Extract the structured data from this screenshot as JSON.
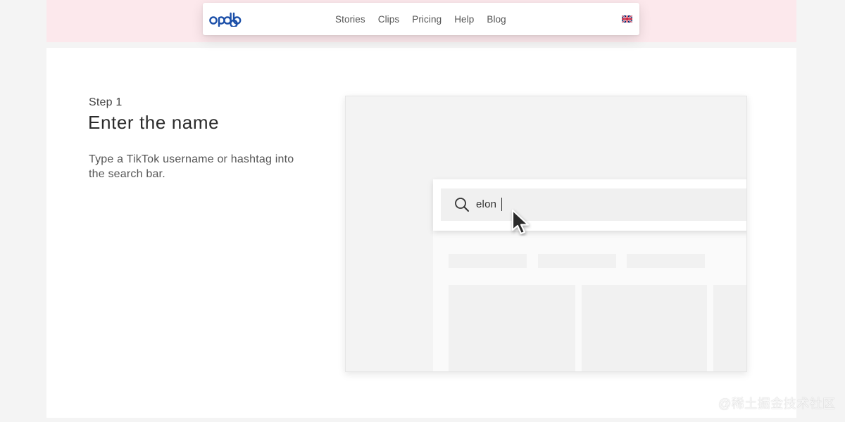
{
  "brand": {
    "logo_text": "opdb",
    "accent": "#1b4fa8"
  },
  "nav": {
    "links": [
      "Stories",
      "Clips",
      "Pricing",
      "Help",
      "Blog"
    ],
    "language_flag": "uk-flag-icon"
  },
  "step": {
    "label": "Step 1",
    "title": "Enter the name",
    "description": "Type a TikTok username or hashtag into the search bar."
  },
  "illustration": {
    "search_value": "elon",
    "search_icon": "search-icon",
    "pointer_icon": "mouse-pointer-icon"
  },
  "watermark": "@稀土掘金技术社区",
  "colors": {
    "top_band": "#fce8ec",
    "page_bg": "#f4f4f4"
  }
}
